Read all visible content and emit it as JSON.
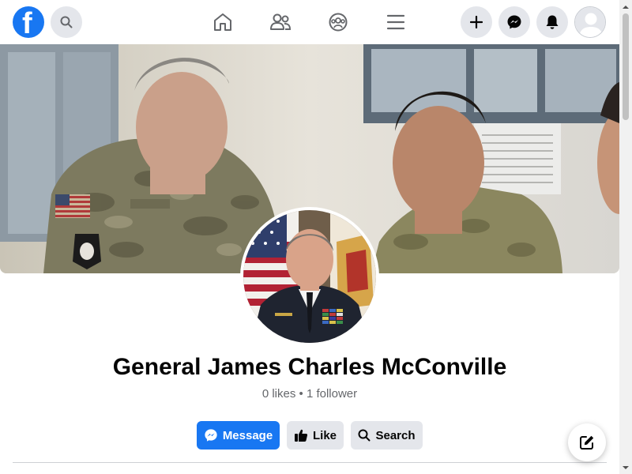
{
  "brand": {
    "logo_letter": "f",
    "accent": "#1877f2"
  },
  "topbar": {
    "icons": [
      "facebook-logo",
      "search-icon",
      "home-icon",
      "friends-icon",
      "groups-icon",
      "menu-icon",
      "plus-icon",
      "messenger-icon",
      "bell-icon",
      "avatar"
    ]
  },
  "profile": {
    "name": "General James Charles McConville",
    "stats": "0 likes • 1 follower"
  },
  "actions": {
    "message_label": "Message",
    "like_label": "Like",
    "search_label": "Search"
  },
  "colors": {
    "primary": "#1877f2",
    "secondary_bg": "#e4e6eb",
    "text": "#050505",
    "muted": "#65676b"
  }
}
